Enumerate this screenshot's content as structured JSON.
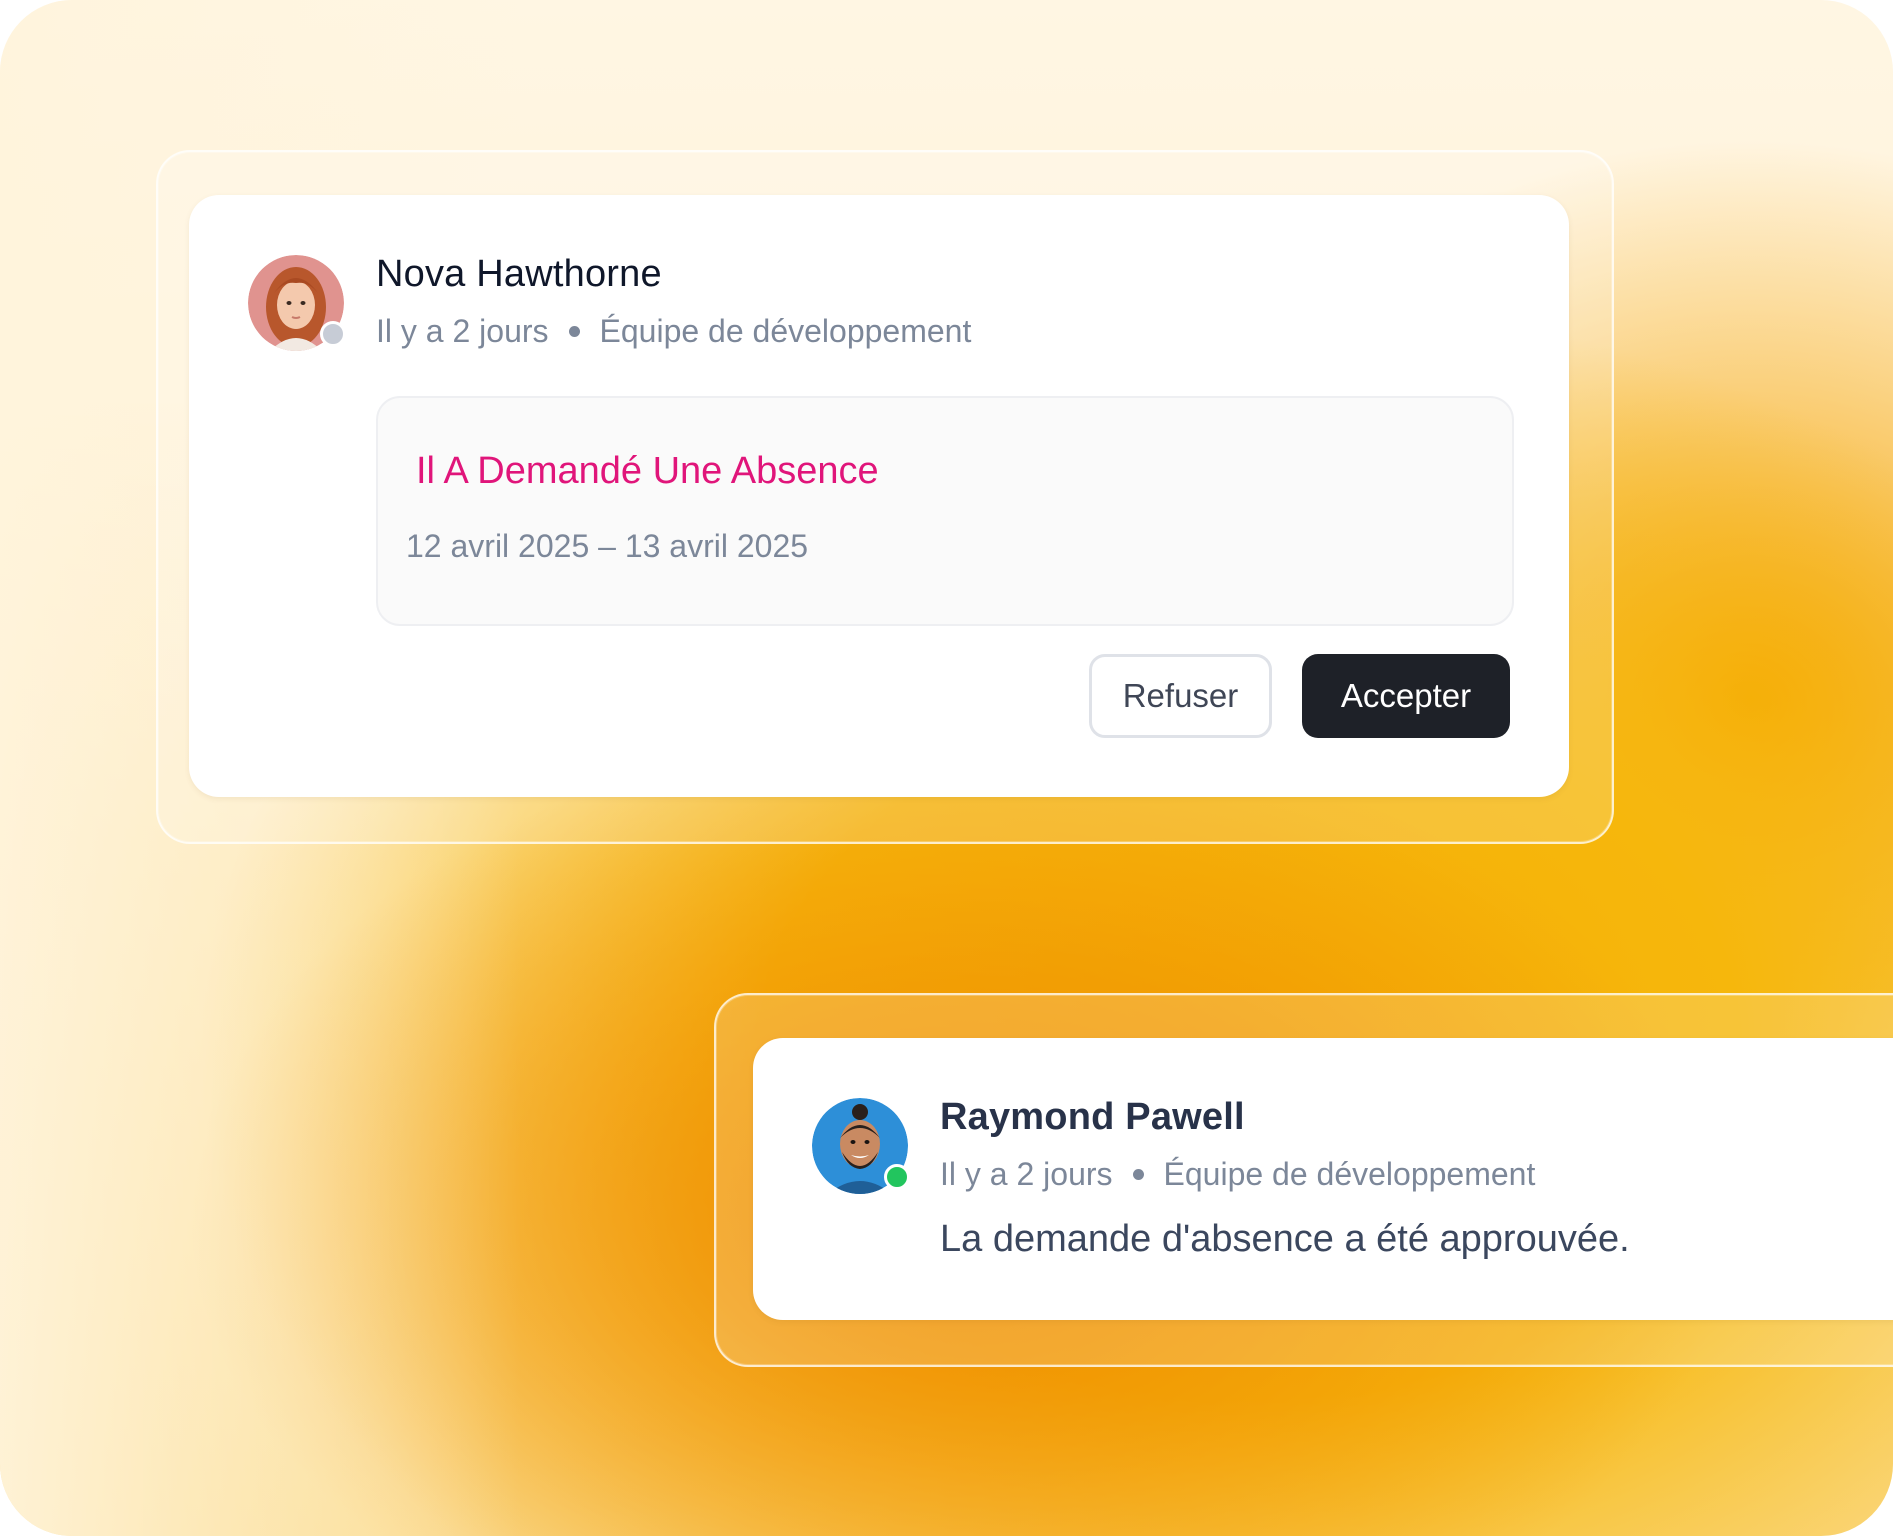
{
  "colors": {
    "accent_pink": "#e0157a",
    "dark_button": "#1e2128",
    "status_offline": "#c7ccd6",
    "status_online": "#22c55e"
  },
  "request_card": {
    "user_name": "Nova Hawthorne",
    "time_ago": "Il y a 2 jours",
    "team": "Équipe de développement",
    "status": "offline",
    "request_title": "Il A Demandé Une Absence",
    "request_dates": "12 avril 2025 – 13 avril 2025",
    "refuse_label": "Refuser",
    "accept_label": "Accepter"
  },
  "approval_card": {
    "user_name": "Raymond Pawell",
    "time_ago": "Il y a 2 jours",
    "team": "Équipe de développement",
    "status": "online",
    "message": "La demande d'absence a été approuvée."
  }
}
